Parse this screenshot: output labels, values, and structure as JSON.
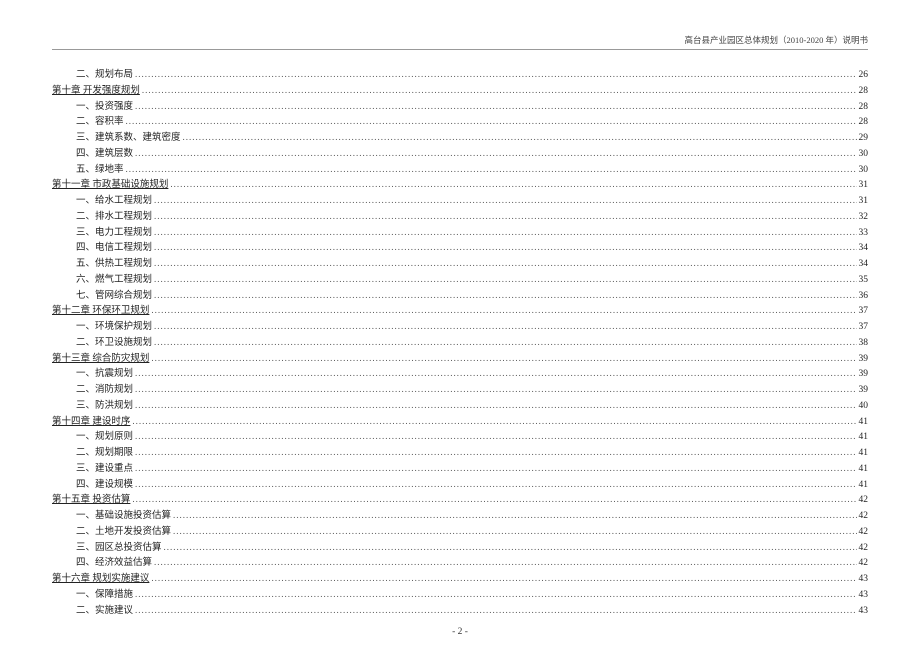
{
  "header": {
    "title": "高台县产业园区总体规划（2010-2020 年）说明书"
  },
  "toc": [
    {
      "level": 1,
      "label": "二、规划布局",
      "page": "26"
    },
    {
      "level": 0,
      "label": "第十章 开发强度规划",
      "page": "28"
    },
    {
      "level": 1,
      "label": "一、投资强度",
      "page": "28"
    },
    {
      "level": 1,
      "label": "二、容积率",
      "page": "28"
    },
    {
      "level": 1,
      "label": "三、建筑系数、建筑密度",
      "page": "29"
    },
    {
      "level": 1,
      "label": "四、建筑层数",
      "page": "30"
    },
    {
      "level": 1,
      "label": "五、绿地率",
      "page": "30"
    },
    {
      "level": 0,
      "label": "第十一章 市政基础设施规划",
      "page": "31"
    },
    {
      "level": 1,
      "label": "一、给水工程规划",
      "page": "31"
    },
    {
      "level": 1,
      "label": "二、排水工程规划",
      "page": "32"
    },
    {
      "level": 1,
      "label": "三、电力工程规划",
      "page": "33"
    },
    {
      "level": 1,
      "label": "四、电信工程规划",
      "page": "34"
    },
    {
      "level": 1,
      "label": "五、供热工程规划",
      "page": "34"
    },
    {
      "level": 1,
      "label": "六、燃气工程规划",
      "page": "35"
    },
    {
      "level": 1,
      "label": "七、管网综合规划",
      "page": "36"
    },
    {
      "level": 0,
      "label": "第十二章 环保环卫规划",
      "page": "37"
    },
    {
      "level": 1,
      "label": "一、环境保护规划",
      "page": "37"
    },
    {
      "level": 1,
      "label": "二、环卫设施规划",
      "page": "38"
    },
    {
      "level": 0,
      "label": "第十三章 综合防灾规划",
      "page": "39"
    },
    {
      "level": 1,
      "label": "一、抗震规划",
      "page": "39"
    },
    {
      "level": 1,
      "label": "二、消防规划",
      "page": "39"
    },
    {
      "level": 1,
      "label": "三、防洪规划",
      "page": "40"
    },
    {
      "level": 0,
      "label": "第十四章 建设时序",
      "page": "41"
    },
    {
      "level": 1,
      "label": "一、规划原则",
      "page": "41"
    },
    {
      "level": 1,
      "label": "二、规划期限",
      "page": "41"
    },
    {
      "level": 1,
      "label": "三、建设重点",
      "page": "41"
    },
    {
      "level": 1,
      "label": "四、建设规模",
      "page": "41"
    },
    {
      "level": 0,
      "label": "第十五章 投资估算",
      "page": "42"
    },
    {
      "level": 1,
      "label": "一、基础设施投资估算",
      "page": "42"
    },
    {
      "level": 1,
      "label": "二、土地开发投资估算",
      "page": "42"
    },
    {
      "level": 1,
      "label": "三、园区总投资估算",
      "page": "42"
    },
    {
      "level": 1,
      "label": "四、经济效益估算",
      "page": "42"
    },
    {
      "level": 0,
      "label": "第十六章 规划实施建议",
      "page": "43"
    },
    {
      "level": 1,
      "label": "一、保障措施",
      "page": "43"
    },
    {
      "level": 1,
      "label": "二、实施建议",
      "page": "43"
    }
  ],
  "footer": {
    "page_label": "- 2 -"
  }
}
